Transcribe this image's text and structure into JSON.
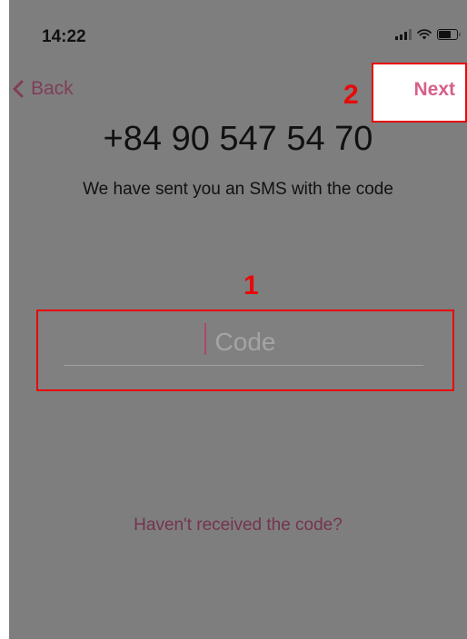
{
  "status_bar": {
    "time": "14:22",
    "icons": [
      "signal-icon",
      "wifi-icon",
      "battery-icon"
    ]
  },
  "nav": {
    "back_label": "Back",
    "next_label": "Next"
  },
  "annotations": {
    "badge_1": "1",
    "badge_2": "2"
  },
  "content": {
    "phone_number": "+84 90 547 54 70",
    "subtitle": "We have sent you an SMS with the code",
    "code_placeholder": "Code",
    "code_value": "",
    "resend_label": "Haven't received the code?"
  },
  "colors": {
    "overlay": "#7e7e7e",
    "accent": "#d65f8a",
    "back_link": "#803d58",
    "annotation_red": "#e80a0a"
  }
}
